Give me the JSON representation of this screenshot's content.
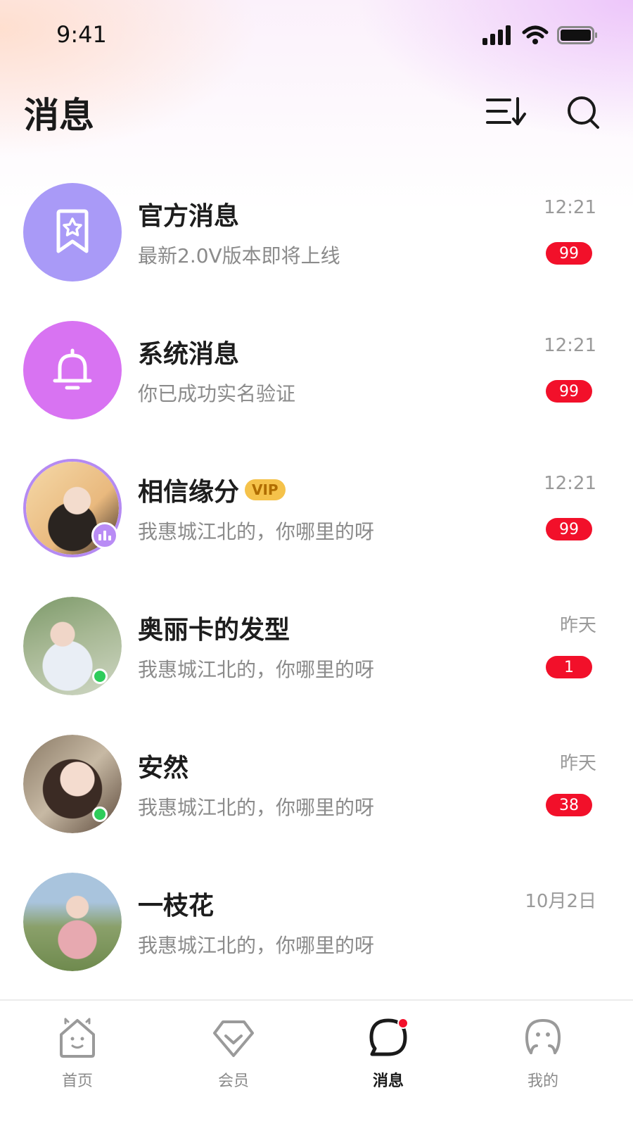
{
  "status_bar": {
    "time": "9:41"
  },
  "header": {
    "title": "消息"
  },
  "conversations": [
    {
      "name": "官方消息",
      "preview": "最新2.0V版本即将上线",
      "time": "12:21",
      "unread": "99",
      "avatar": "star-bookmark-icon"
    },
    {
      "name": "系统消息",
      "preview": "你已成功实名验证",
      "time": "12:21",
      "unread": "99",
      "avatar": "bell-icon"
    },
    {
      "name": "相信缘分",
      "vip": "VIP",
      "preview": "我惠城江北的，你哪里的呀",
      "time": "12:21",
      "unread": "99",
      "avatar": "user-photo"
    },
    {
      "name": "奥丽卡的发型",
      "preview": "我惠城江北的，你哪里的呀",
      "time": "昨天",
      "unread": "1",
      "avatar": "user-photo"
    },
    {
      "name": "安然",
      "preview": "我惠城江北的，你哪里的呀",
      "time": "昨天",
      "unread": "38",
      "avatar": "user-photo"
    },
    {
      "name": "一枝花",
      "preview": "我惠城江北的，你哪里的呀",
      "time": "10月2日",
      "avatar": "user-photo"
    }
  ],
  "tabbar": {
    "items": [
      {
        "label": "首页",
        "icon": "home-icon"
      },
      {
        "label": "会员",
        "icon": "diamond-icon"
      },
      {
        "label": "消息",
        "icon": "chat-icon",
        "active": true
      },
      {
        "label": "我的",
        "icon": "profile-icon"
      }
    ]
  },
  "colors": {
    "unread_badge": "#f2102a",
    "online_dot": "#2ecc5a",
    "official_avatar": "#a99af7",
    "system_avatar": "#d873f2",
    "vip_badge": "#f5c24a"
  }
}
